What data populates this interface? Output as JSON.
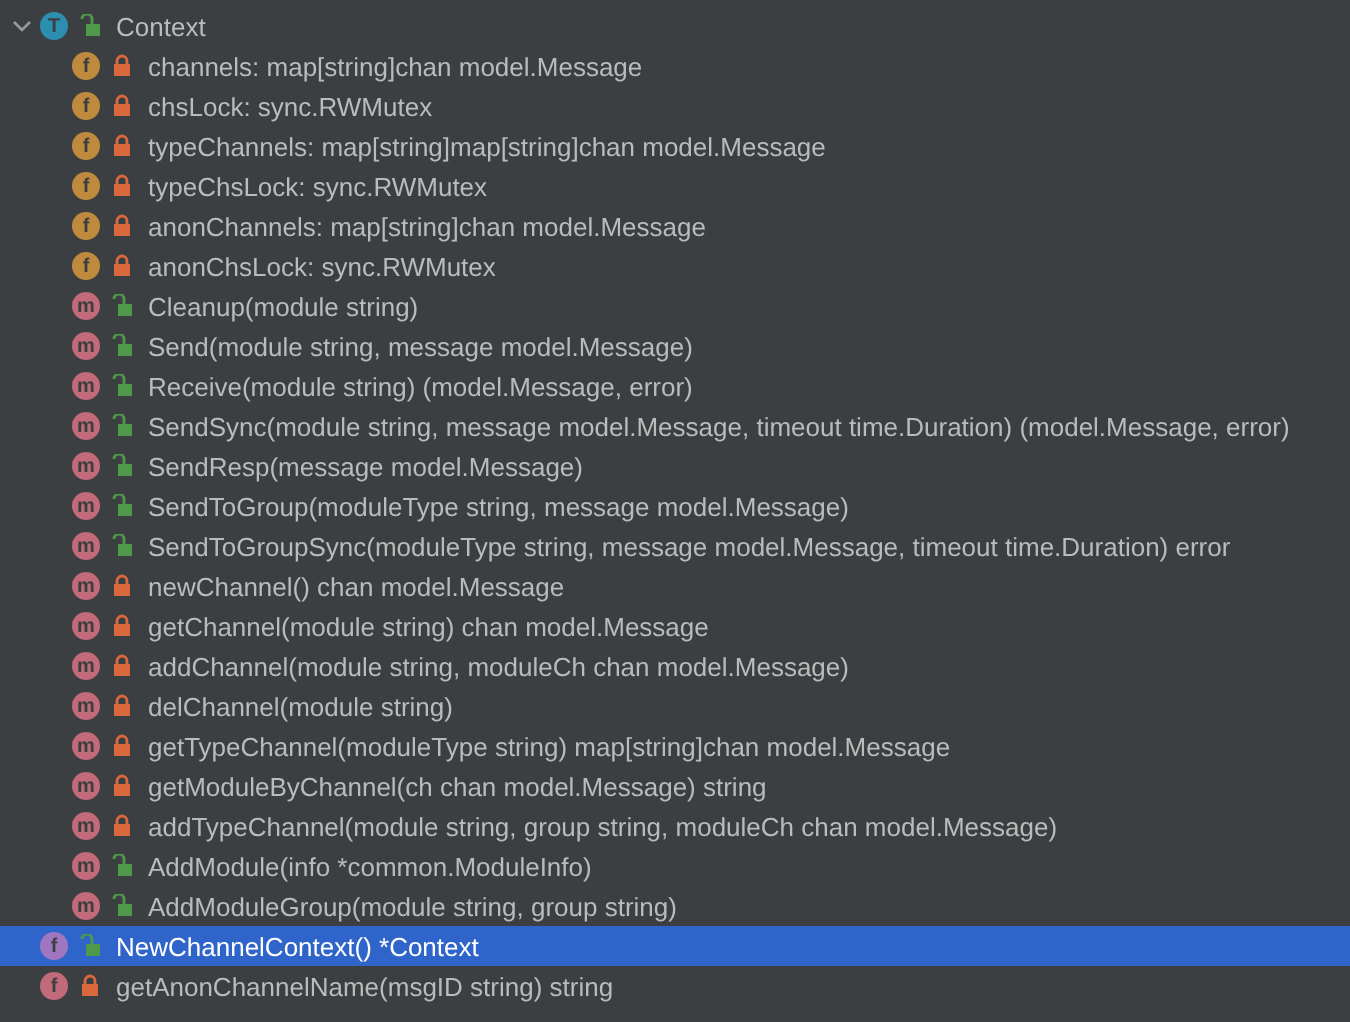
{
  "tree": [
    {
      "kind": "type",
      "badge": "T",
      "public": true,
      "label": "Context",
      "expanded": true,
      "selected": false,
      "children": [
        {
          "kind": "field",
          "badge": "f",
          "public": false,
          "label": "channels: map[string]chan model.Message",
          "selected": false
        },
        {
          "kind": "field",
          "badge": "f",
          "public": false,
          "label": "chsLock: sync.RWMutex",
          "selected": false
        },
        {
          "kind": "field",
          "badge": "f",
          "public": false,
          "label": "typeChannels: map[string]map[string]chan model.Message",
          "selected": false
        },
        {
          "kind": "field",
          "badge": "f",
          "public": false,
          "label": "typeChsLock: sync.RWMutex",
          "selected": false
        },
        {
          "kind": "field",
          "badge": "f",
          "public": false,
          "label": "anonChannels: map[string]chan model.Message",
          "selected": false
        },
        {
          "kind": "field",
          "badge": "f",
          "public": false,
          "label": "anonChsLock: sync.RWMutex",
          "selected": false
        },
        {
          "kind": "method",
          "badge": "m",
          "public": true,
          "label": "Cleanup(module string)",
          "selected": false
        },
        {
          "kind": "method",
          "badge": "m",
          "public": true,
          "label": "Send(module string, message model.Message)",
          "selected": false
        },
        {
          "kind": "method",
          "badge": "m",
          "public": true,
          "label": "Receive(module string) (model.Message, error)",
          "selected": false
        },
        {
          "kind": "method",
          "badge": "m",
          "public": true,
          "label": "SendSync(module string, message model.Message, timeout time.Duration) (model.Message, error)",
          "selected": false
        },
        {
          "kind": "method",
          "badge": "m",
          "public": true,
          "label": "SendResp(message model.Message)",
          "selected": false
        },
        {
          "kind": "method",
          "badge": "m",
          "public": true,
          "label": "SendToGroup(moduleType string, message model.Message)",
          "selected": false
        },
        {
          "kind": "method",
          "badge": "m",
          "public": true,
          "label": "SendToGroupSync(moduleType string, message model.Message, timeout time.Duration) error",
          "selected": false
        },
        {
          "kind": "method",
          "badge": "m",
          "public": false,
          "label": "newChannel() chan model.Message",
          "selected": false
        },
        {
          "kind": "method",
          "badge": "m",
          "public": false,
          "label": "getChannel(module string) chan model.Message",
          "selected": false
        },
        {
          "kind": "method",
          "badge": "m",
          "public": false,
          "label": "addChannel(module string, moduleCh chan model.Message)",
          "selected": false
        },
        {
          "kind": "method",
          "badge": "m",
          "public": false,
          "label": "delChannel(module string)",
          "selected": false
        },
        {
          "kind": "method",
          "badge": "m",
          "public": false,
          "label": "getTypeChannel(moduleType string) map[string]chan model.Message",
          "selected": false
        },
        {
          "kind": "method",
          "badge": "m",
          "public": false,
          "label": "getModuleByChannel(ch chan model.Message) string",
          "selected": false
        },
        {
          "kind": "method",
          "badge": "m",
          "public": false,
          "label": "addTypeChannel(module string, group string, moduleCh chan model.Message)",
          "selected": false
        },
        {
          "kind": "method",
          "badge": "m",
          "public": true,
          "label": "AddModule(info *common.ModuleInfo)",
          "selected": false
        },
        {
          "kind": "method",
          "badge": "m",
          "public": true,
          "label": "AddModuleGroup(module string, group string)",
          "selected": false
        }
      ]
    },
    {
      "kind": "function",
      "badge": "f",
      "public": true,
      "label": "NewChannelContext() *Context",
      "selected": true
    },
    {
      "kind": "function",
      "badge": "f",
      "public": false,
      "label": "getAnonChannelName(msgID string) string",
      "selected": false
    }
  ]
}
